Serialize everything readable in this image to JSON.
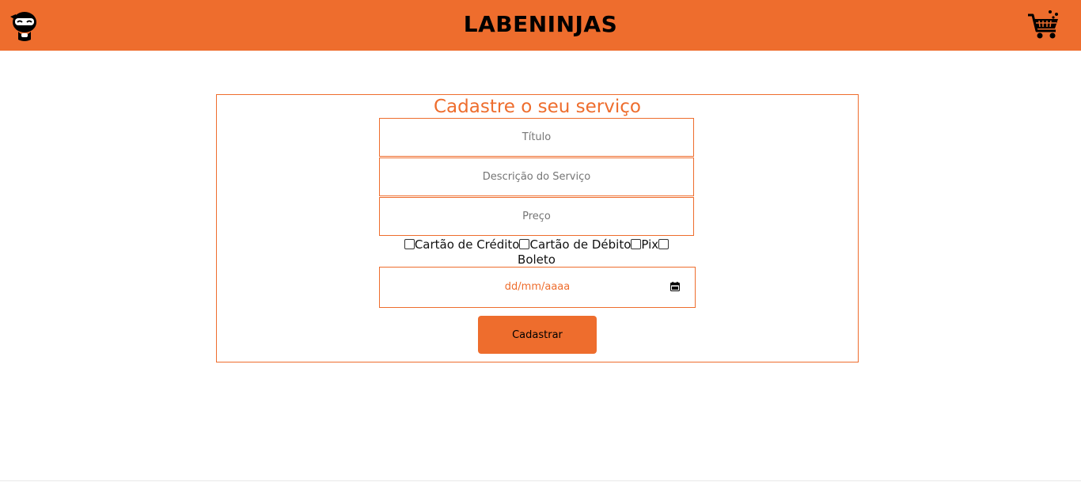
{
  "header": {
    "brand": "LABENINJAS",
    "logo_icon": "ninja-logo-icon",
    "cart_icon": "shopping-cart-icon",
    "background_color": "#ee6d2d"
  },
  "form": {
    "title": "Cadastre o seu serviço",
    "fields": [
      {
        "name": "titulo",
        "placeholder": "Título"
      },
      {
        "name": "descricao",
        "placeholder": "Descrição do Serviço"
      },
      {
        "name": "preco",
        "placeholder": "Preço"
      }
    ],
    "payment_methods": [
      {
        "label": "Cartão de Crédito",
        "checked": false
      },
      {
        "label": "Cartão de Débito",
        "checked": false
      },
      {
        "label": "Pix",
        "checked": false
      },
      {
        "label": "Boleto",
        "checked": false
      }
    ],
    "date_placeholder": "dd/mm/aaaa",
    "date_icon": "calendar-icon",
    "submit_label": "Cadastrar",
    "accent_color": "#ee6d2d"
  }
}
